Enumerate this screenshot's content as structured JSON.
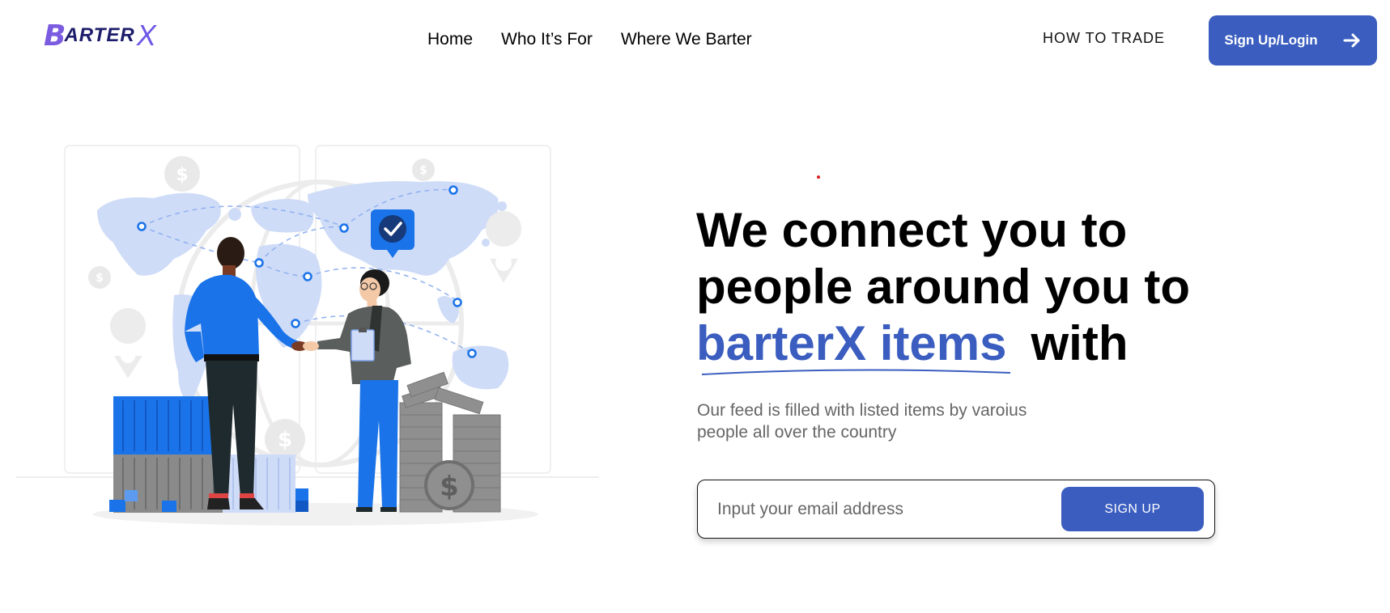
{
  "brand": {
    "logo_b": "B",
    "logo_text": "ARTER",
    "logo_x": "X"
  },
  "nav": {
    "items": [
      {
        "label": "Home"
      },
      {
        "label": "Who It’s For"
      },
      {
        "label": "Where We Barter"
      }
    ]
  },
  "header": {
    "how_to_trade": "HOW TO TRADE",
    "signup_login": "Sign Up/Login"
  },
  "hero": {
    "line1": "We connect you to",
    "line2": "people around you to",
    "accent": "barterX items",
    "line3_end": "with",
    "subtext": "Our feed is filled with listed items by varoius people all over the country"
  },
  "email_form": {
    "placeholder": "Input your email address",
    "value": "",
    "button_label": "SIGN UP"
  },
  "colors": {
    "primary": "#3a5dbf",
    "logo_purple": "#7b5ce0",
    "illustration_blue": "#1a73e8",
    "map_light": "#cfdcf7"
  },
  "icons": [
    "arrow-right-icon",
    "checkmark-icon",
    "dollar-icon",
    "location-pin-icon"
  ]
}
